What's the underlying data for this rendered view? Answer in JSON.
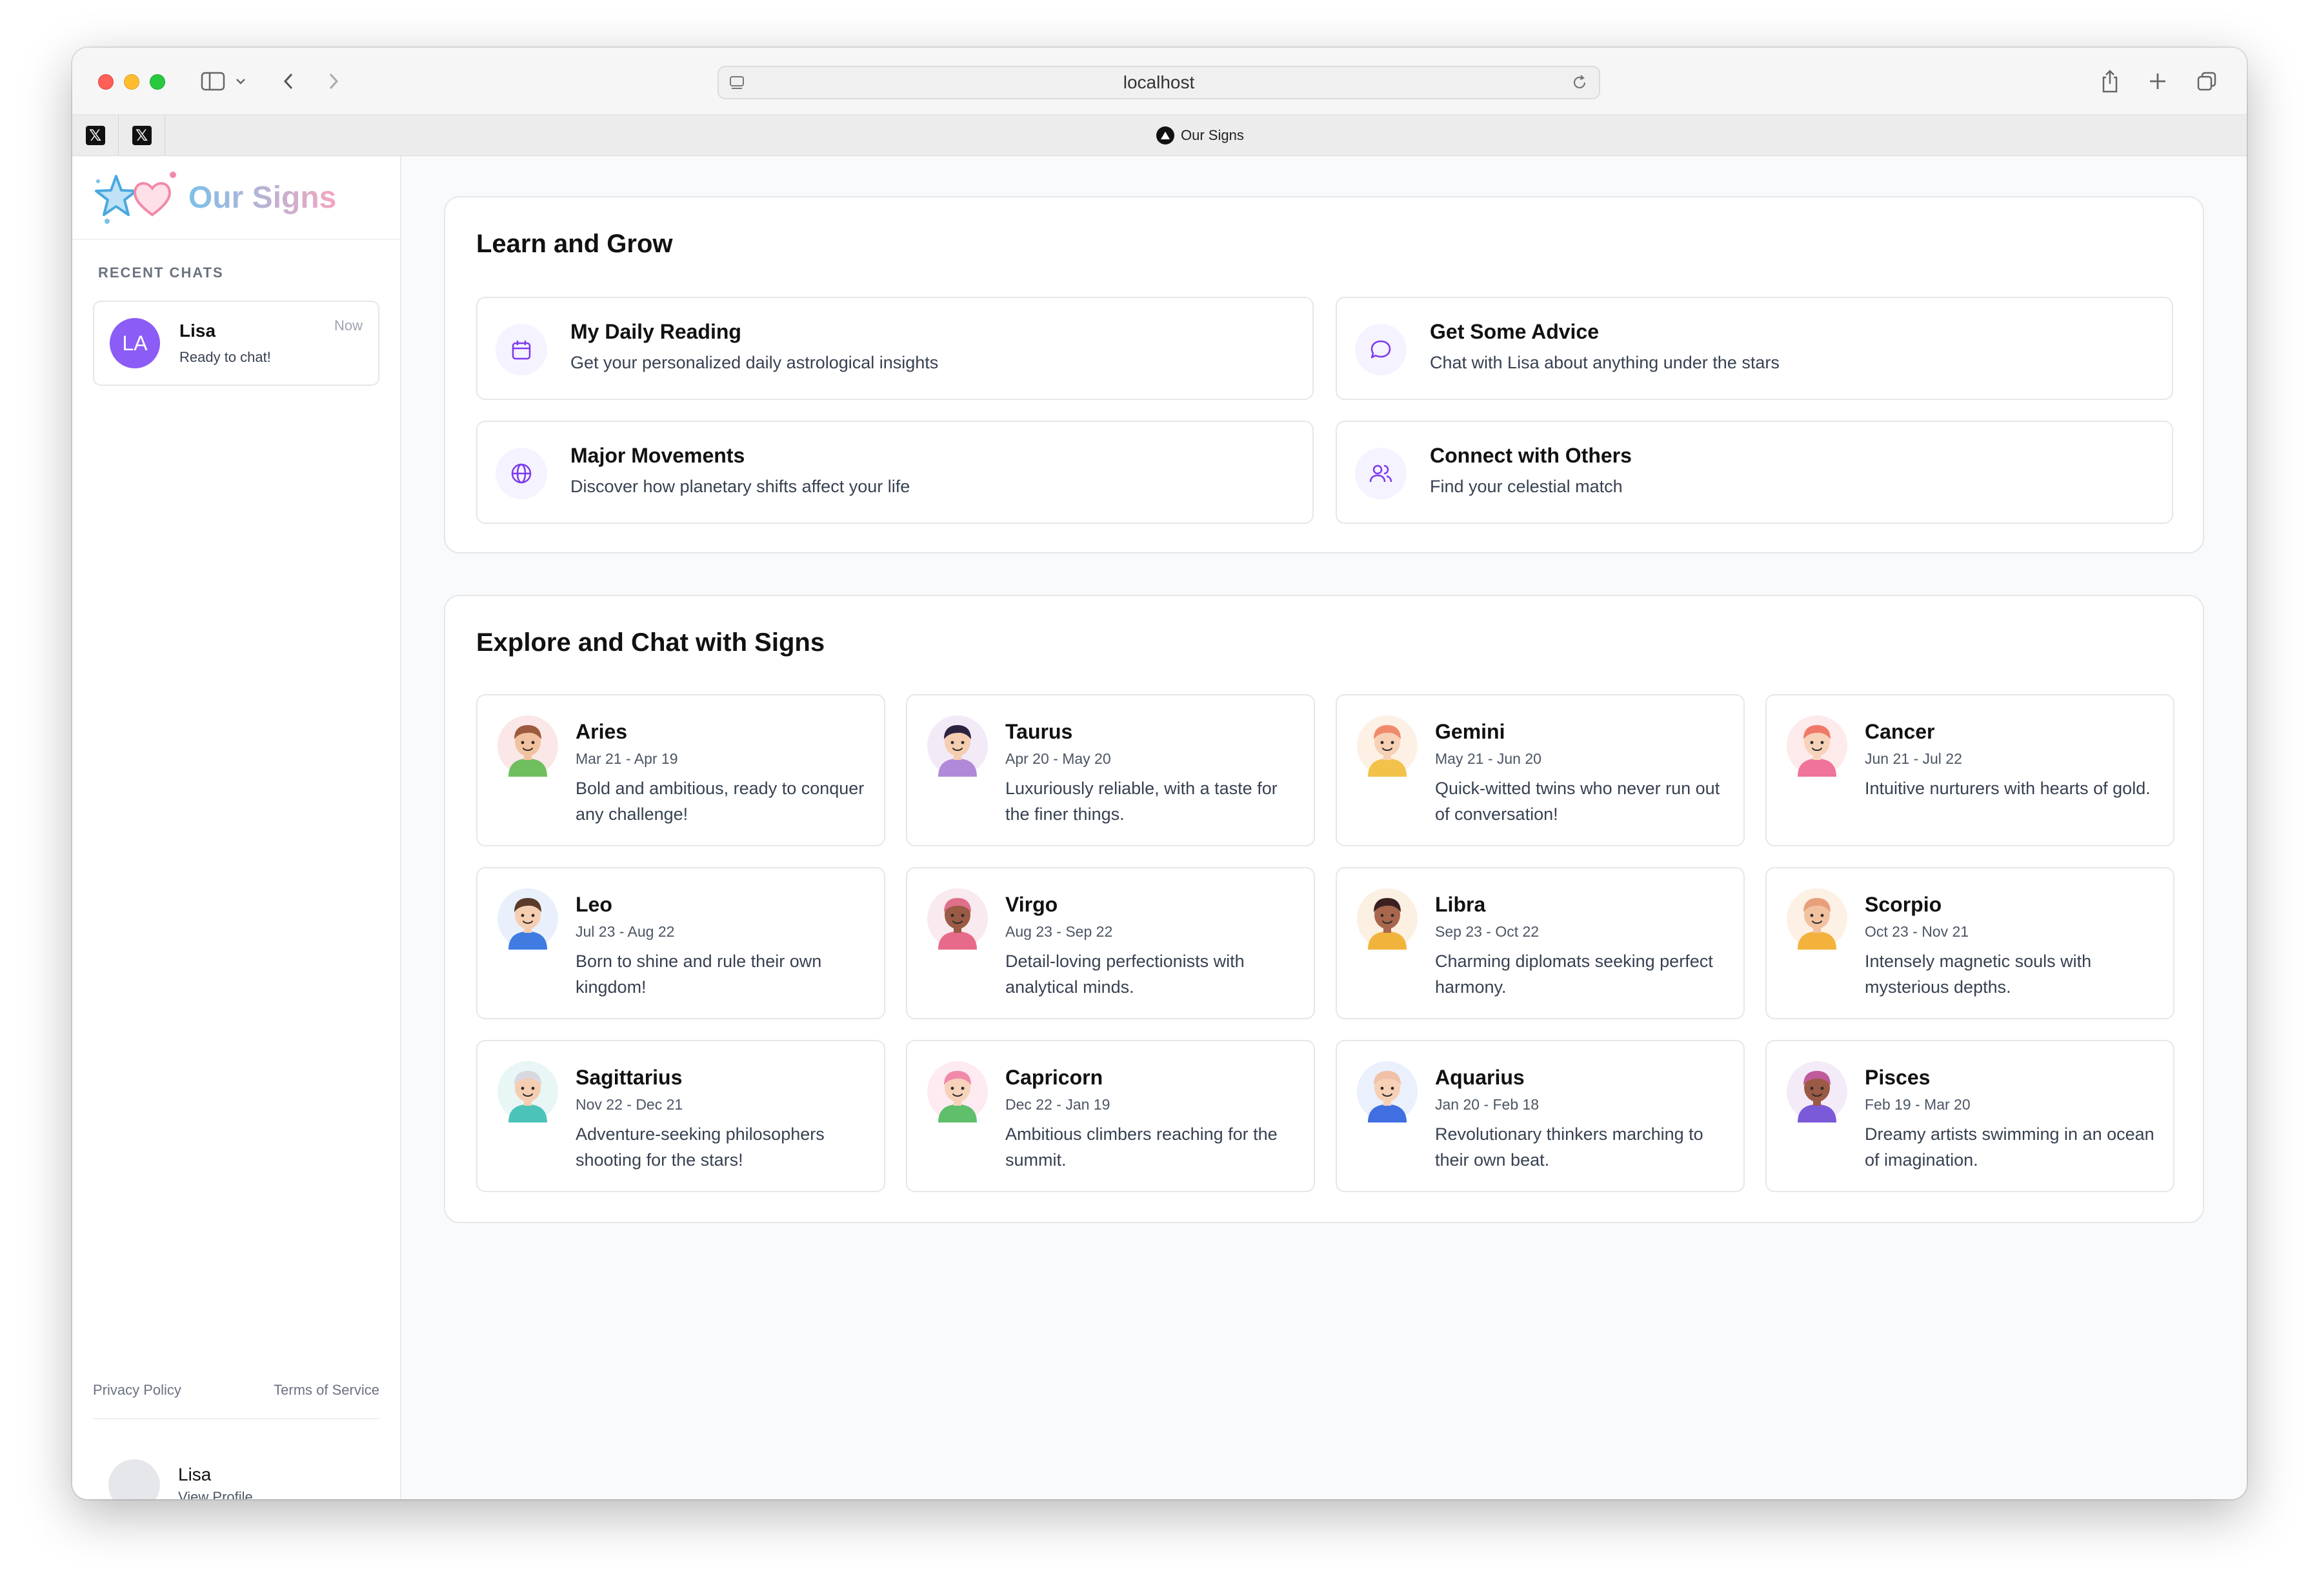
{
  "browser": {
    "url": "localhost",
    "tab_title": "Our Signs"
  },
  "sidebar": {
    "brand": "Our Signs",
    "section_label": "RECENT CHATS",
    "chats": [
      {
        "initials": "LA",
        "name": "Lisa",
        "status": "Ready to chat!",
        "time": "Now"
      }
    ],
    "links": {
      "privacy": "Privacy Policy",
      "terms": "Terms of Service"
    },
    "profile": {
      "name": "Lisa",
      "link": "View Profile"
    }
  },
  "learn": {
    "title": "Learn and Grow",
    "features": [
      {
        "icon": "calendar-icon",
        "title": "My Daily Reading",
        "desc": "Get your personalized daily astrological insights"
      },
      {
        "icon": "chat-bubble-icon",
        "title": "Get Some Advice",
        "desc": "Chat with Lisa about anything under the stars"
      },
      {
        "icon": "globe-icon",
        "title": "Major Movements",
        "desc": "Discover how planetary shifts affect your life"
      },
      {
        "icon": "users-icon",
        "title": "Connect with Others",
        "desc": "Find your celestial match"
      }
    ]
  },
  "explore": {
    "title": "Explore and Chat with Signs",
    "signs": [
      {
        "name": "Aries",
        "dates": "Mar 21 - Apr 19",
        "desc": "Bold and ambitious, ready to conquer any challenge!",
        "hair": "#9b5b3c",
        "skin": "#f2c2a0",
        "shirt": "#6fbf5f",
        "bg": "#fbe7e7"
      },
      {
        "name": "Taurus",
        "dates": "Apr 20 - May 20",
        "desc": "Luxuriously reliable, with a taste for the finer things.",
        "hair": "#2d2340",
        "skin": "#f5cdb0",
        "shirt": "#b08ad8",
        "bg": "#f3eaf8"
      },
      {
        "name": "Gemini",
        "dates": "May 21 - Jun 20",
        "desc": "Quick-witted twins who never run out of conversation!",
        "hair": "#f08a6c",
        "skin": "#f7d0b6",
        "shirt": "#f3c24a",
        "bg": "#fdf1e6"
      },
      {
        "name": "Cancer",
        "dates": "Jun 21 - Jul 22",
        "desc": "Intuitive nurturers with hearts of gold.",
        "hair": "#f07a68",
        "skin": "#f7d2bb",
        "shirt": "#f0739c",
        "bg": "#fdeaea"
      },
      {
        "name": "Leo",
        "dates": "Jul 23 - Aug 22",
        "desc": "Born to shine and rule their own kingdom!",
        "hair": "#5a3a2a",
        "skin": "#f5cdb0",
        "shirt": "#3f7be0",
        "bg": "#e9f0fb"
      },
      {
        "name": "Virgo",
        "dates": "Aug 23 - Sep 22",
        "desc": "Detail-loving perfectionists with analytical minds.",
        "hair": "#e0708a",
        "skin": "#9a5a45",
        "shirt": "#e86a8a",
        "bg": "#f8eaee"
      },
      {
        "name": "Libra",
        "dates": "Sep 23 - Oct 22",
        "desc": "Charming diplomats seeking perfect harmony.",
        "hair": "#3a2020",
        "skin": "#a8674d",
        "shirt": "#f2b33d",
        "bg": "#fbf0e2"
      },
      {
        "name": "Scorpio",
        "dates": "Oct 23 - Nov 21",
        "desc": "Intensely magnetic souls with mysterious depths.",
        "hair": "#e8a07a",
        "skin": "#f2c2a0",
        "shirt": "#f3b23c",
        "bg": "#fdf1e6"
      },
      {
        "name": "Sagittarius",
        "dates": "Nov 22 - Dec 21",
        "desc": "Adventure-seeking philosophers shooting for the stars!",
        "hair": "#d8d8e0",
        "skin": "#f5cdb0",
        "shirt": "#4cc3b8",
        "bg": "#e8f6f5"
      },
      {
        "name": "Capricorn",
        "dates": "Dec 22 - Jan 19",
        "desc": "Ambitious climbers reaching for the summit.",
        "hair": "#f08aa8",
        "skin": "#f7d2bb",
        "shirt": "#5fbf6a",
        "bg": "#fdebf1"
      },
      {
        "name": "Aquarius",
        "dates": "Jan 20 - Feb 18",
        "desc": "Revolutionary thinkers marching to their own beat.",
        "hair": "#f0c0a8",
        "skin": "#f7d0b6",
        "shirt": "#3f6fe0",
        "bg": "#eaf0fc"
      },
      {
        "name": "Pisces",
        "dates": "Feb 19 - Mar 20",
        "desc": "Dreamy artists swimming in an ocean of imagination.",
        "hair": "#c05a9a",
        "skin": "#9a5a45",
        "shirt": "#7a5ad8",
        "bg": "#f3ebf8"
      }
    ]
  },
  "colors": {
    "accent": "#8b5cf6",
    "icon_purple": "#7c3aed"
  }
}
